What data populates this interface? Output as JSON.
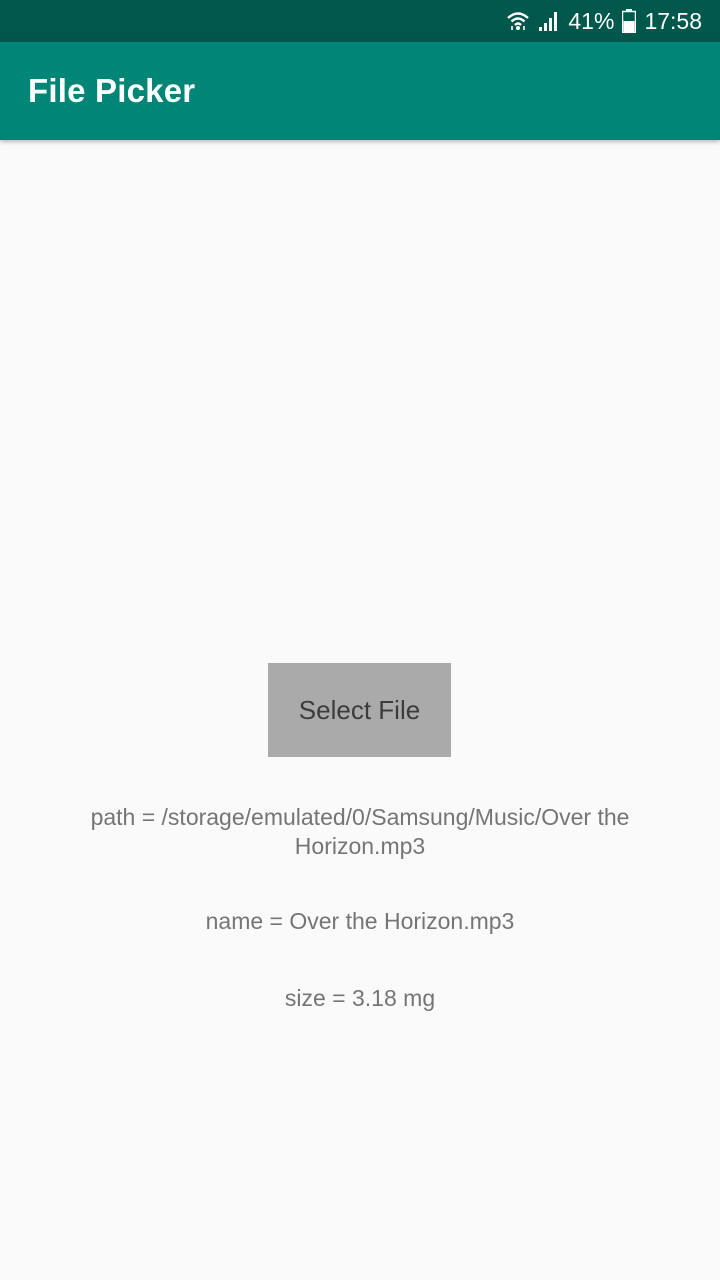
{
  "status_bar": {
    "wifi_icon": "wifi-icon",
    "signal_icon": "signal-icon",
    "battery_percent": "41%",
    "battery_icon": "battery-icon",
    "time": "17:58"
  },
  "app_bar": {
    "title": "File Picker"
  },
  "main": {
    "select_button_label": "Select File",
    "path_text": "path = /storage/emulated/0/Samsung/Music/Over the Horizon.mp3",
    "name_text": "name = Over the Horizon.mp3",
    "size_text": "size = 3.18 mg"
  },
  "colors": {
    "status_bar": "#00574b",
    "app_bar": "#008577",
    "background": "#fafafa",
    "button": "#aaaaaa",
    "info_text": "#757575"
  }
}
